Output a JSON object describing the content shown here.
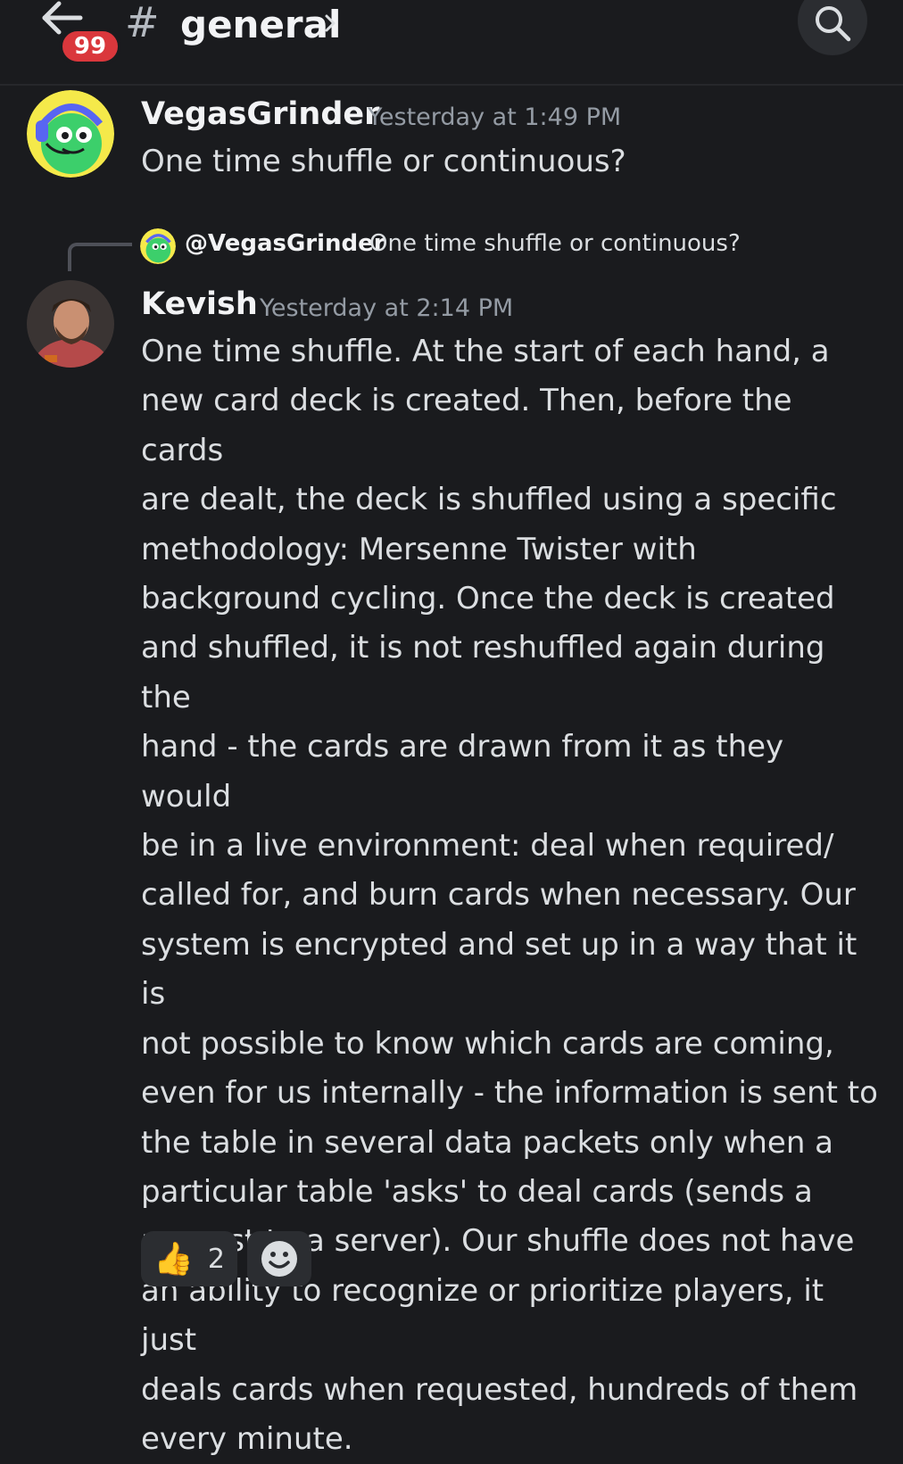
{
  "header": {
    "unread_count": "99",
    "hash": "#",
    "channel_name": "general"
  },
  "messages": [
    {
      "author": "VegasGrinder",
      "timestamp": "Yesterday at 1:49 PM",
      "text": "One time shuffle or continuous?"
    },
    {
      "reply_to": {
        "author": "@VegasGrinder",
        "text": "One time shuffle or continuous?"
      },
      "author": "Kevish",
      "timestamp": "Yesterday at 2:14 PM",
      "lines": [
        "One time shuffle. At the start of each hand, a",
        "new card deck is created. Then, before the cards",
        "are dealt, the deck is shuffled using a specific",
        "methodology: Mersenne Twister with",
        "background cycling. Once the deck is created",
        "and shuffled, it is not reshuffled again during the",
        "hand - the cards are drawn from it as they would",
        "be in a live environment: deal when required/",
        "called for, and burn cards when necessary. Our",
        "system is encrypted and set up in a way that it is",
        "not possible to know which cards are coming,",
        "even for us internally - the information is sent to",
        "the table in several data packets only when a",
        "particular table 'asks' to deal cards (sends a",
        "request to a server). Our shuffle does not have",
        "an ability to recognize or prioritize players, it just",
        "deals cards when requested, hundreds of them",
        "every minute."
      ],
      "reactions": [
        {
          "icon": "thumbs-up-icon",
          "emoji": "👍",
          "count": "2"
        },
        {
          "icon": "add-reaction-icon",
          "count": ""
        }
      ]
    }
  ],
  "colors": {
    "background": "#1a1b1e",
    "badge": "#da373c",
    "text": "#dbdee1",
    "muted": "#949ba4"
  }
}
